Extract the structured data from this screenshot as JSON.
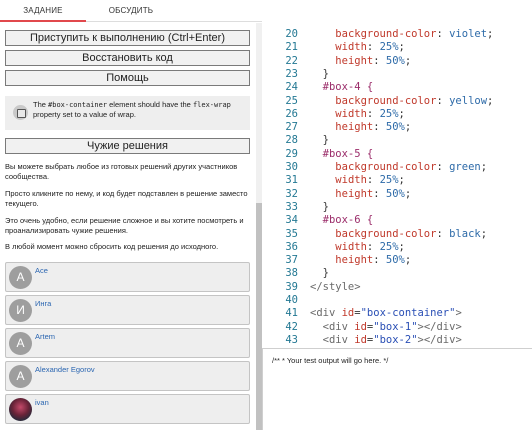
{
  "tabs": {
    "task": "ЗАДАНИЕ",
    "discuss": "ОБСУДИТЬ"
  },
  "buttons": {
    "run": "Приступить к выполнению (Ctrl+Enter)",
    "reset": "Восстановить код",
    "help": "Помощь",
    "solutions": "Чужие решения"
  },
  "hint": {
    "part1": "The ",
    "code1": "#box-container",
    "part2": " element should have the ",
    "code2": "flex-wrap",
    "part3": " property set to a value of wrap."
  },
  "paragraphs": [
    "Вы можете выбрать любое из готовых решений других участников сообщества.",
    "Просто кликните по нему, и код будет подставлен в решение заместо текущего.",
    "Это очень удобно, если решение сложное и вы хотите посмотреть и проанализировать чужие решения.",
    "В любой момент можно сбросить код решения до исходного."
  ],
  "users": [
    {
      "name": "Ace",
      "initial": "A"
    },
    {
      "name": "Инга",
      "initial": "И"
    },
    {
      "name": "Artem",
      "initial": "A"
    },
    {
      "name": "Alexander Egorov",
      "initial": "A"
    },
    {
      "name": "ivan",
      "initial": ""
    }
  ],
  "code_lines": [
    {
      "n": "20",
      "indent": "    ",
      "prop": "background-color",
      "val": "violet"
    },
    {
      "n": "21",
      "indent": "    ",
      "prop": "width",
      "val": "25%"
    },
    {
      "n": "22",
      "indent": "    ",
      "prop": "height",
      "val": "50%"
    },
    {
      "n": "23",
      "text": "  }"
    },
    {
      "n": "24",
      "selector": "  #box-4 {"
    },
    {
      "n": "25",
      "indent": "    ",
      "prop": "background-color",
      "val": "yellow"
    },
    {
      "n": "26",
      "indent": "    ",
      "prop": "width",
      "val": "25%"
    },
    {
      "n": "27",
      "indent": "    ",
      "prop": "height",
      "val": "50%"
    },
    {
      "n": "28",
      "text": "  }"
    },
    {
      "n": "29",
      "selector": "  #box-5 {"
    },
    {
      "n": "30",
      "indent": "    ",
      "prop": "background-color",
      "val": "green"
    },
    {
      "n": "31",
      "indent": "    ",
      "prop": "width",
      "val": "25%"
    },
    {
      "n": "32",
      "indent": "    ",
      "prop": "height",
      "val": "50%"
    },
    {
      "n": "33",
      "text": "  }"
    },
    {
      "n": "34",
      "selector": "  #box-6 {"
    },
    {
      "n": "35",
      "indent": "    ",
      "prop": "background-color",
      "val": "black"
    },
    {
      "n": "36",
      "indent": "    ",
      "prop": "width",
      "val": "25%"
    },
    {
      "n": "37",
      "indent": "    ",
      "prop": "height",
      "val": "50%"
    },
    {
      "n": "38",
      "text": "  }"
    },
    {
      "n": "39",
      "tagline": "</style>"
    },
    {
      "n": "40",
      "text": ""
    },
    {
      "n": "41",
      "div": {
        "indent": "",
        "id": "box-container",
        "close": false
      }
    },
    {
      "n": "42",
      "div": {
        "indent": "  ",
        "id": "box-1",
        "close": true
      }
    },
    {
      "n": "43",
      "div": {
        "indent": "  ",
        "id": "box-2",
        "close": true
      }
    }
  ],
  "output": {
    "text": "/** * Your test output will go here. */"
  }
}
